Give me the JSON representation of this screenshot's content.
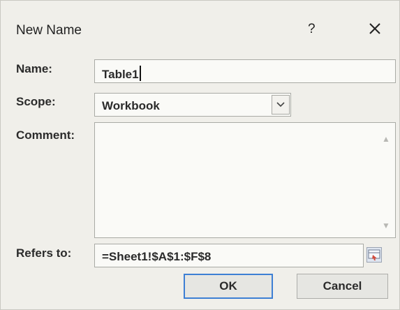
{
  "dialog": {
    "title": "New Name",
    "help": "?"
  },
  "form": {
    "name_label": "Name:",
    "name_value": "Table1",
    "scope_label": "Scope:",
    "scope_value": "Workbook",
    "comment_label": "Comment:",
    "comment_value": "",
    "refers_label": "Refers to:",
    "refers_value": "=Sheet1!$A$1:$F$8"
  },
  "buttons": {
    "ok_label": "OK",
    "cancel_label": "Cancel"
  }
}
